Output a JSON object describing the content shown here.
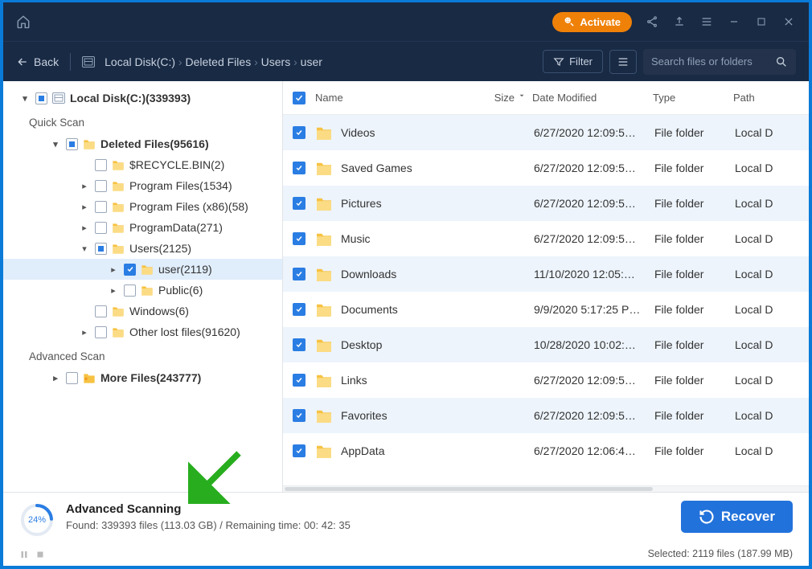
{
  "titlebar": {
    "activate_label": "Activate"
  },
  "toolbar": {
    "back_label": "Back",
    "breadcrumb": [
      "Local Disk(C:)",
      "Deleted Files",
      "Users",
      "user"
    ],
    "filter_label": "Filter",
    "search_placeholder": "Search files or folders"
  },
  "sidebar": {
    "root_label": "Local Disk(C:)(339393)",
    "quick_scan": "Quick Scan",
    "advanced_scan": "Advanced Scan",
    "items": [
      {
        "indent": 1,
        "arrow": "down",
        "cb": "partial",
        "bold": true,
        "label": "Deleted Files(95616)"
      },
      {
        "indent": 2,
        "arrow": "",
        "cb": "empty",
        "bold": false,
        "label": "$RECYCLE.BIN(2)"
      },
      {
        "indent": 2,
        "arrow": "right",
        "cb": "empty",
        "bold": false,
        "label": "Program Files(1534)"
      },
      {
        "indent": 2,
        "arrow": "right",
        "cb": "empty",
        "bold": false,
        "label": "Program Files (x86)(58)"
      },
      {
        "indent": 2,
        "arrow": "right",
        "cb": "empty",
        "bold": false,
        "label": "ProgramData(271)"
      },
      {
        "indent": 2,
        "arrow": "down",
        "cb": "partial",
        "bold": false,
        "label": "Users(2125)"
      },
      {
        "indent": 3,
        "arrow": "right",
        "cb": "checked",
        "bold": false,
        "label": "user(2119)",
        "sel": true
      },
      {
        "indent": 3,
        "arrow": "right",
        "cb": "empty",
        "bold": false,
        "label": "Public(6)"
      },
      {
        "indent": 2,
        "arrow": "",
        "cb": "empty",
        "bold": false,
        "label": "Windows(6)"
      },
      {
        "indent": 2,
        "arrow": "right",
        "cb": "empty",
        "bold": false,
        "label": "Other lost files(91620)"
      }
    ],
    "more_files_label": "More Files(243777)"
  },
  "filelist": {
    "headers": {
      "name": "Name",
      "size": "Size",
      "date": "Date Modified",
      "type": "Type",
      "path": "Path"
    },
    "rows": [
      {
        "name": "Videos",
        "date": "6/27/2020 12:09:5…",
        "type": "File folder",
        "path": "Local D"
      },
      {
        "name": "Saved Games",
        "date": "6/27/2020 12:09:5…",
        "type": "File folder",
        "path": "Local D"
      },
      {
        "name": "Pictures",
        "date": "6/27/2020 12:09:5…",
        "type": "File folder",
        "path": "Local D"
      },
      {
        "name": "Music",
        "date": "6/27/2020 12:09:5…",
        "type": "File folder",
        "path": "Local D"
      },
      {
        "name": "Downloads",
        "date": "11/10/2020 12:05:…",
        "type": "File folder",
        "path": "Local D"
      },
      {
        "name": "Documents",
        "date": "9/9/2020 5:17:25 P…",
        "type": "File folder",
        "path": "Local D"
      },
      {
        "name": "Desktop",
        "date": "10/28/2020 10:02:…",
        "type": "File folder",
        "path": "Local D"
      },
      {
        "name": "Links",
        "date": "6/27/2020 12:09:5…",
        "type": "File folder",
        "path": "Local D"
      },
      {
        "name": "Favorites",
        "date": "6/27/2020 12:09:5…",
        "type": "File folder",
        "path": "Local D"
      },
      {
        "name": "AppData",
        "date": "6/27/2020 12:06:4…",
        "type": "File folder",
        "path": "Local D"
      }
    ]
  },
  "bottom": {
    "percent": "24%",
    "scan_title": "Advanced Scanning",
    "scan_sub": "Found: 339393 files (113.03 GB) / Remaining time: 00: 42: 35",
    "recover_label": "Recover",
    "selected_label": "Selected: 2119 files (187.99 MB)"
  }
}
